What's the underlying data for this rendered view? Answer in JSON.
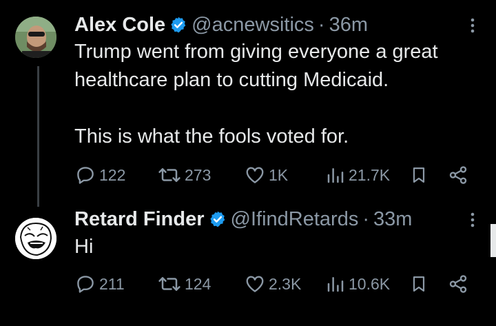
{
  "tweets": [
    {
      "name": "Alex Cole",
      "handle": "@acnewsitics",
      "separator": "·",
      "time": "36m",
      "text": "Trump went from giving everyone a great healthcare plan to cutting Medicaid.\n\nThis is what the fools voted for.",
      "stats": {
        "replies": "122",
        "reposts": "273",
        "likes": "1K",
        "views": "21.7K"
      }
    },
    {
      "name": "Retard Finder",
      "handle": "@IfindRetards",
      "separator": "·",
      "time": "33m",
      "text": "Hi",
      "stats": {
        "replies": "211",
        "reposts": "124",
        "likes": "2.3K",
        "views": "10.6K"
      }
    }
  ],
  "icons": {
    "verified": "verified-badge-icon",
    "reply": "reply-icon",
    "repost": "repost-icon",
    "like": "like-icon",
    "views": "views-icon",
    "bookmark": "bookmark-icon",
    "share": "share-icon",
    "more": "more-options-icon"
  },
  "colors": {
    "background": "#000000",
    "primary_text": "#e7e9ea",
    "secondary_text": "#8b98a5",
    "verified_blue": "#1d9bf0"
  }
}
